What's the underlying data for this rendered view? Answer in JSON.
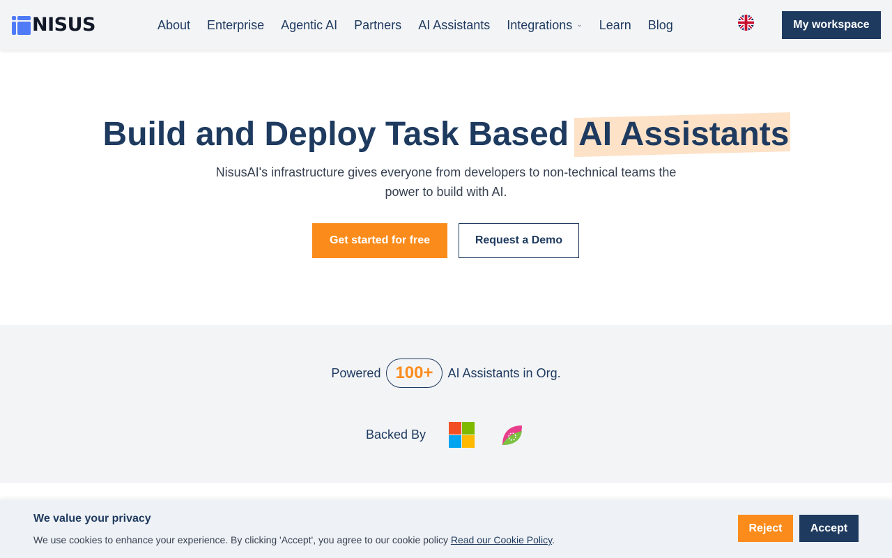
{
  "brand": {
    "logo_text": "NISUS"
  },
  "nav": {
    "items": [
      {
        "label": "About"
      },
      {
        "label": "Enterprise"
      },
      {
        "label": "Agentic AI"
      },
      {
        "label": "Partners"
      },
      {
        "label": "AI Assistants"
      },
      {
        "label": "Integrations",
        "has_dropdown": true
      },
      {
        "label": "Learn"
      },
      {
        "label": "Blog"
      }
    ],
    "language_icon": "uk-flag-icon",
    "workspace_label": "My workspace"
  },
  "hero": {
    "title_main": "Build and Deploy Task Based",
    "title_highlight": "AI Assistants",
    "subtitle": "NisusAI's infrastructure gives everyone from developers to non-technical teams the power to build with AI.",
    "primary_cta": "Get started for free",
    "secondary_cta": "Request a Demo"
  },
  "stats": {
    "powered_label": "Powered",
    "count": "100+",
    "count_suffix": "AI Assistants in Org.",
    "backed_label": "Backed By",
    "backers": [
      "microsoft-logo-icon",
      "leaf-logo-icon"
    ]
  },
  "cookie": {
    "title": "We value your privacy",
    "text": "We use cookies to enhance your experience. By clicking 'Accept', you agree to our cookie policy",
    "link": "Read our Cookie Policy",
    "period": ".",
    "reject": "Reject",
    "accept": "Accept"
  },
  "colors": {
    "navy": "#1e3a5f",
    "orange": "#fb8c1c",
    "highlight": "#fde2c8",
    "band": "#f3f4f6"
  }
}
